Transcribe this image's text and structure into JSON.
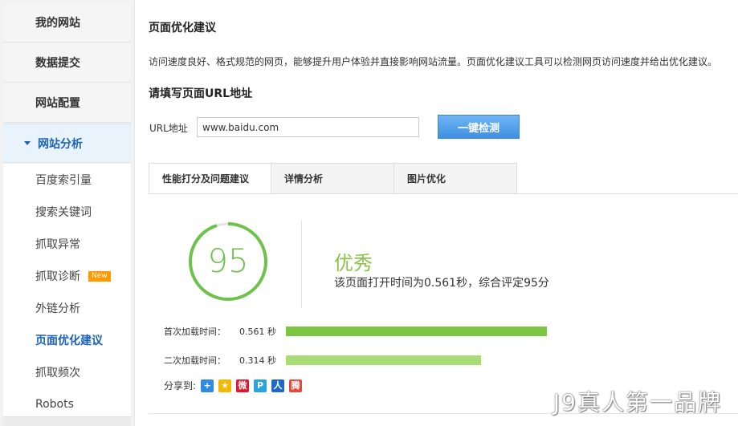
{
  "sidebar": {
    "main_items": [
      {
        "label": "我的网站"
      },
      {
        "label": "数据提交"
      },
      {
        "label": "网站配置"
      },
      {
        "label": "网站分析"
      }
    ],
    "sub_items": [
      {
        "label": "百度索引量"
      },
      {
        "label": "搜索关键词"
      },
      {
        "label": "抓取异常"
      },
      {
        "label": "抓取诊断",
        "badge": "New"
      },
      {
        "label": "外链分析"
      },
      {
        "label": "页面优化建议"
      },
      {
        "label": "抓取频次"
      },
      {
        "label": "Robots"
      }
    ]
  },
  "main": {
    "title": "页面优化建议",
    "description": "访问速度良好、格式规范的网页，能够提升用户体验并直接影响网站流量。页面优化建议工具可以检测网页访问速度并给出优化建议。",
    "url_section_title": "请填写页面URL地址",
    "url_label": "URL地址",
    "url_value": "www.baidu.com",
    "check_button": "一键检测",
    "tabs": [
      {
        "label": "性能打分及问题建议"
      },
      {
        "label": "详情分析"
      },
      {
        "label": "图片优化"
      }
    ],
    "score": 95,
    "rating": "优秀",
    "rating_desc": "该页面打开时间为0.561秒，综合评定95分",
    "load_times": [
      {
        "label": "首次加载时间：",
        "value": "0.561 秒",
        "fill": 1.0,
        "color": "#7dc642"
      },
      {
        "label": "二次加载时间：",
        "value": "0.314 秒",
        "fill": 0.749,
        "color": "#a8dc74"
      }
    ],
    "share_label": "分享到:",
    "share_icons": [
      {
        "name": "qzone-add-icon",
        "glyph": "+",
        "color": "#2f8be0"
      },
      {
        "name": "qzone-star-icon",
        "glyph": "★",
        "color": "#f5b700"
      },
      {
        "name": "weibo-icon",
        "glyph": "微",
        "color": "#e6162d"
      },
      {
        "name": "pengyou-icon",
        "glyph": "P",
        "color": "#2aa3e5"
      },
      {
        "name": "renren-icon",
        "glyph": "人",
        "color": "#1f6ac7"
      },
      {
        "name": "tencent-weibo-icon",
        "glyph": "腾",
        "color": "#e24b3c"
      }
    ]
  },
  "watermark": "J9真人第一品牌",
  "colors": {
    "accent": "#1a62b8",
    "score": "#6cc24a",
    "button": "#4d9ae8"
  }
}
